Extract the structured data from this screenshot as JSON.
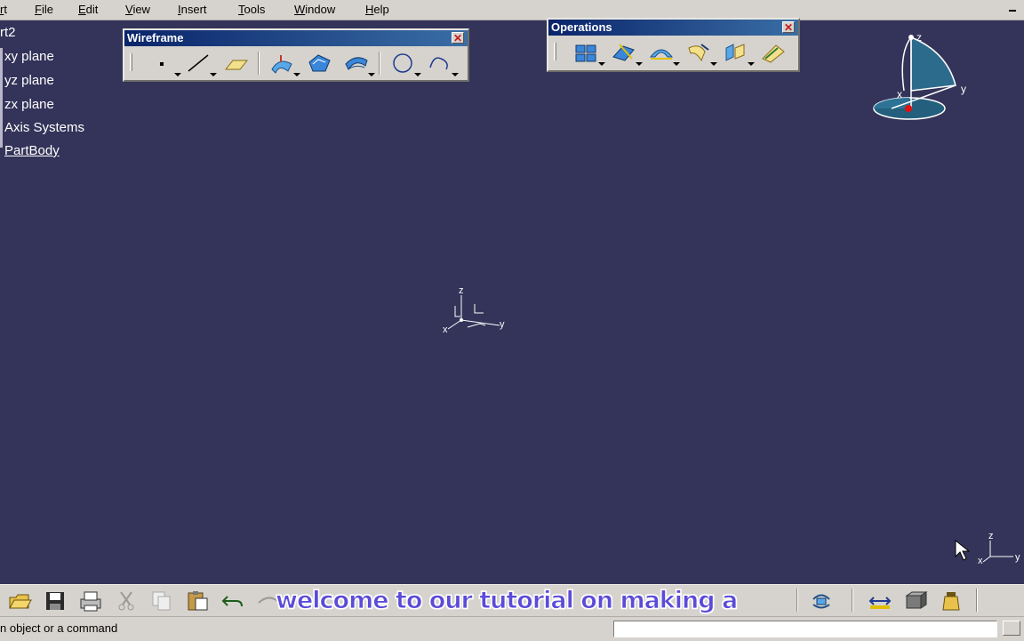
{
  "menu": {
    "items": [
      "rt",
      "File",
      "Edit",
      "View",
      "Insert",
      "Tools",
      "Window",
      "Help"
    ]
  },
  "tree": {
    "root": "rt2",
    "items": [
      "xy plane",
      "yz plane",
      "zx plane",
      "Axis Systems",
      "PartBody"
    ]
  },
  "wireframe_toolbar": {
    "title": "Wireframe",
    "close_label": "✕",
    "icons": [
      "point-icon",
      "line-icon",
      "plane-icon",
      "extrude-icon",
      "fill-icon",
      "offset-icon",
      "circle-icon",
      "spline-icon"
    ]
  },
  "operations_toolbar": {
    "title": "Operations",
    "close_label": "✕",
    "icons": [
      "join-icon",
      "split-icon",
      "fillet-icon",
      "translate-icon",
      "extrapolate-icon",
      "boundary-icon"
    ]
  },
  "compass": {
    "x_label": "x",
    "y_label": "y",
    "z_label": "z"
  },
  "origin_axis": {
    "x_label": "x",
    "y_label": "y",
    "z_label": "z"
  },
  "corner_axis": {
    "x_label": "x",
    "y_label": "y",
    "z_label": "z"
  },
  "bottom_toolbar": {
    "icons": [
      "open-icon",
      "save-icon",
      "print-icon",
      "cut-icon",
      "copy-icon",
      "paste-icon",
      "undo-icon",
      "redo-icon",
      "update-icon",
      "measure-icon",
      "apply-material-icon",
      "weight-icon"
    ]
  },
  "caption": "welcome to our tutorial on making a",
  "status": {
    "message": "n object or a command",
    "command_value": ""
  },
  "colors": {
    "viewport_bg": "#343359",
    "toolbar_bg": "#d6d3ce",
    "titlebar_start": "#0a246a",
    "titlebar_end": "#3a6ea5",
    "caption_fill": "#5b4bd8"
  }
}
